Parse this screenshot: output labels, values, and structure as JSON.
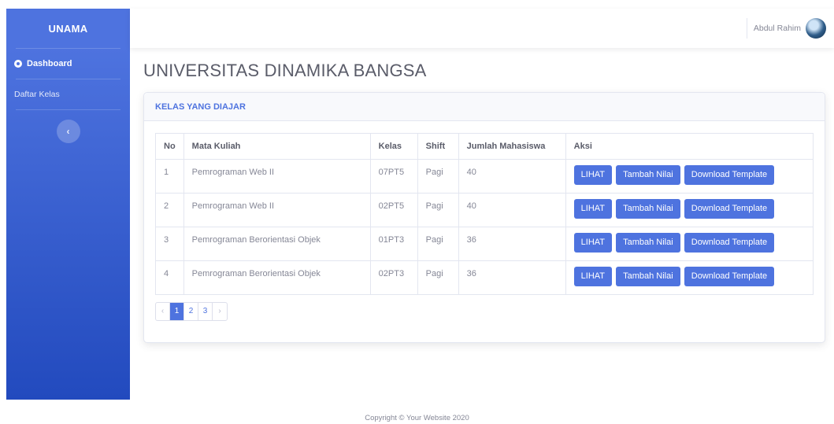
{
  "sidebar": {
    "brand": "UNAMA",
    "items": [
      {
        "label": "Dashboard",
        "icon": "tachometer-icon",
        "active": true
      },
      {
        "label": "Daftar Kelas",
        "active": false
      }
    ],
    "toggle_icon": "‹"
  },
  "topbar": {
    "user_name": "Abdul Rahim"
  },
  "page_title": "UNIVERSITAS DINAMIKA BANGSA",
  "card": {
    "title": "KELAS YANG DIAJAR",
    "table": {
      "headers": [
        "No",
        "Mata Kuliah",
        "Kelas",
        "Shift",
        "Jumlah Mahasiswa",
        "Aksi"
      ],
      "rows": [
        {
          "no": "1",
          "mata_kuliah": "Pemrograman Web II",
          "kelas": "07PT5",
          "shift": "Pagi",
          "jumlah": "40"
        },
        {
          "no": "2",
          "mata_kuliah": "Pemrograman Web II",
          "kelas": "02PT5",
          "shift": "Pagi",
          "jumlah": "40"
        },
        {
          "no": "3",
          "mata_kuliah": "Pemrograman Berorientasi Objek",
          "kelas": "01PT3",
          "shift": "Pagi",
          "jumlah": "36"
        },
        {
          "no": "4",
          "mata_kuliah": "Pemrograman Berorientasi Objek",
          "kelas": "02PT3",
          "shift": "Pagi",
          "jumlah": "36"
        }
      ],
      "actions": {
        "lihat": "LIHAT",
        "tambah": "Tambah Nilai",
        "download": "Download Template"
      }
    },
    "pagination": {
      "prev": "‹",
      "pages": [
        "1",
        "2",
        "3"
      ],
      "active": "1",
      "next": "›"
    }
  },
  "footer": "Copyright © Your Website 2020",
  "colors": {
    "primary": "#4e73df",
    "primary_dark": "#224abe",
    "text": "#858796",
    "heading": "#5a5c69"
  }
}
